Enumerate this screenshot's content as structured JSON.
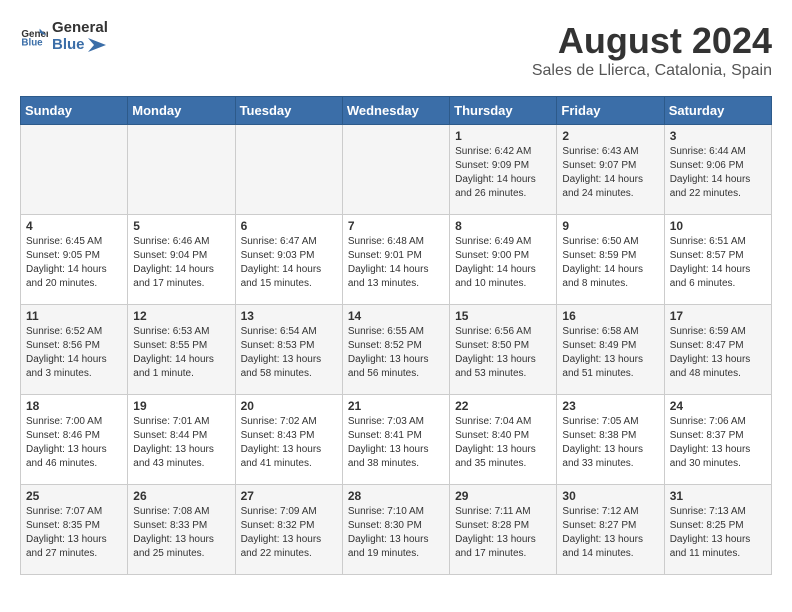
{
  "logo": {
    "general": "General",
    "blue": "Blue"
  },
  "title": "August 2024",
  "subtitle": "Sales de Llierca, Catalonia, Spain",
  "days_of_week": [
    "Sunday",
    "Monday",
    "Tuesday",
    "Wednesday",
    "Thursday",
    "Friday",
    "Saturday"
  ],
  "weeks": [
    [
      {
        "day": "",
        "info": ""
      },
      {
        "day": "",
        "info": ""
      },
      {
        "day": "",
        "info": ""
      },
      {
        "day": "",
        "info": ""
      },
      {
        "day": "1",
        "info": "Sunrise: 6:42 AM\nSunset: 9:09 PM\nDaylight: 14 hours and 26 minutes."
      },
      {
        "day": "2",
        "info": "Sunrise: 6:43 AM\nSunset: 9:07 PM\nDaylight: 14 hours and 24 minutes."
      },
      {
        "day": "3",
        "info": "Sunrise: 6:44 AM\nSunset: 9:06 PM\nDaylight: 14 hours and 22 minutes."
      }
    ],
    [
      {
        "day": "4",
        "info": "Sunrise: 6:45 AM\nSunset: 9:05 PM\nDaylight: 14 hours and 20 minutes."
      },
      {
        "day": "5",
        "info": "Sunrise: 6:46 AM\nSunset: 9:04 PM\nDaylight: 14 hours and 17 minutes."
      },
      {
        "day": "6",
        "info": "Sunrise: 6:47 AM\nSunset: 9:03 PM\nDaylight: 14 hours and 15 minutes."
      },
      {
        "day": "7",
        "info": "Sunrise: 6:48 AM\nSunset: 9:01 PM\nDaylight: 14 hours and 13 minutes."
      },
      {
        "day": "8",
        "info": "Sunrise: 6:49 AM\nSunset: 9:00 PM\nDaylight: 14 hours and 10 minutes."
      },
      {
        "day": "9",
        "info": "Sunrise: 6:50 AM\nSunset: 8:59 PM\nDaylight: 14 hours and 8 minutes."
      },
      {
        "day": "10",
        "info": "Sunrise: 6:51 AM\nSunset: 8:57 PM\nDaylight: 14 hours and 6 minutes."
      }
    ],
    [
      {
        "day": "11",
        "info": "Sunrise: 6:52 AM\nSunset: 8:56 PM\nDaylight: 14 hours and 3 minutes."
      },
      {
        "day": "12",
        "info": "Sunrise: 6:53 AM\nSunset: 8:55 PM\nDaylight: 14 hours and 1 minute."
      },
      {
        "day": "13",
        "info": "Sunrise: 6:54 AM\nSunset: 8:53 PM\nDaylight: 13 hours and 58 minutes."
      },
      {
        "day": "14",
        "info": "Sunrise: 6:55 AM\nSunset: 8:52 PM\nDaylight: 13 hours and 56 minutes."
      },
      {
        "day": "15",
        "info": "Sunrise: 6:56 AM\nSunset: 8:50 PM\nDaylight: 13 hours and 53 minutes."
      },
      {
        "day": "16",
        "info": "Sunrise: 6:58 AM\nSunset: 8:49 PM\nDaylight: 13 hours and 51 minutes."
      },
      {
        "day": "17",
        "info": "Sunrise: 6:59 AM\nSunset: 8:47 PM\nDaylight: 13 hours and 48 minutes."
      }
    ],
    [
      {
        "day": "18",
        "info": "Sunrise: 7:00 AM\nSunset: 8:46 PM\nDaylight: 13 hours and 46 minutes."
      },
      {
        "day": "19",
        "info": "Sunrise: 7:01 AM\nSunset: 8:44 PM\nDaylight: 13 hours and 43 minutes."
      },
      {
        "day": "20",
        "info": "Sunrise: 7:02 AM\nSunset: 8:43 PM\nDaylight: 13 hours and 41 minutes."
      },
      {
        "day": "21",
        "info": "Sunrise: 7:03 AM\nSunset: 8:41 PM\nDaylight: 13 hours and 38 minutes."
      },
      {
        "day": "22",
        "info": "Sunrise: 7:04 AM\nSunset: 8:40 PM\nDaylight: 13 hours and 35 minutes."
      },
      {
        "day": "23",
        "info": "Sunrise: 7:05 AM\nSunset: 8:38 PM\nDaylight: 13 hours and 33 minutes."
      },
      {
        "day": "24",
        "info": "Sunrise: 7:06 AM\nSunset: 8:37 PM\nDaylight: 13 hours and 30 minutes."
      }
    ],
    [
      {
        "day": "25",
        "info": "Sunrise: 7:07 AM\nSunset: 8:35 PM\nDaylight: 13 hours and 27 minutes."
      },
      {
        "day": "26",
        "info": "Sunrise: 7:08 AM\nSunset: 8:33 PM\nDaylight: 13 hours and 25 minutes."
      },
      {
        "day": "27",
        "info": "Sunrise: 7:09 AM\nSunset: 8:32 PM\nDaylight: 13 hours and 22 minutes."
      },
      {
        "day": "28",
        "info": "Sunrise: 7:10 AM\nSunset: 8:30 PM\nDaylight: 13 hours and 19 minutes."
      },
      {
        "day": "29",
        "info": "Sunrise: 7:11 AM\nSunset: 8:28 PM\nDaylight: 13 hours and 17 minutes."
      },
      {
        "day": "30",
        "info": "Sunrise: 7:12 AM\nSunset: 8:27 PM\nDaylight: 13 hours and 14 minutes."
      },
      {
        "day": "31",
        "info": "Sunrise: 7:13 AM\nSunset: 8:25 PM\nDaylight: 13 hours and 11 minutes."
      }
    ]
  ]
}
